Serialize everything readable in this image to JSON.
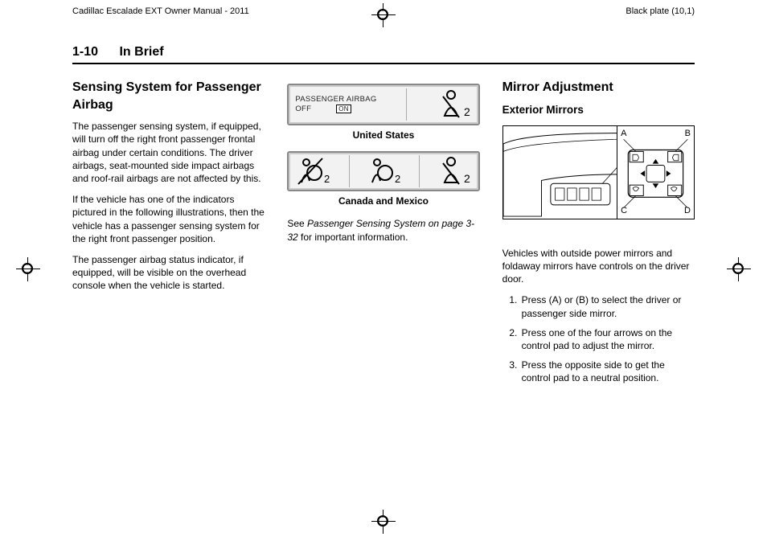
{
  "header": {
    "left": "Cadillac Escalade EXT Owner Manual - 2011",
    "right": "Black plate (10,1)"
  },
  "page": {
    "number": "1-10",
    "section": "In Brief"
  },
  "col1": {
    "h2": "Sensing System for Passenger Airbag",
    "p1": "The passenger sensing system, if equipped, will turn off the right front passenger frontal airbag under certain conditions. The driver airbags, seat-mounted side impact airbags and roof-rail airbags are not affected by this.",
    "p2": "If the vehicle has one of the indicators pictured in the following illustrations, then the vehicle has a passenger sensing system for the right front passenger position.",
    "p3": "The passenger airbag status indicator, if equipped, will be visible on the overhead console when the vehicle is started."
  },
  "col2": {
    "indicator_us_line1": "PASSENGER AIRBAG",
    "indicator_us_off": "OFF",
    "indicator_us_on": "ON",
    "caption_us": "United States",
    "caption_ca": "Canada and Mexico",
    "see_prefix": "See ",
    "see_ref": "Passenger Sensing System on page 3-32",
    "see_suffix": " for important information."
  },
  "col3": {
    "h2": "Mirror Adjustment",
    "h3": "Exterior Mirrors",
    "labels": {
      "A": "A",
      "B": "B",
      "C": "C",
      "D": "D"
    },
    "p1": "Vehicles with outside power mirrors and foldaway mirrors have controls on the driver door.",
    "li1": "Press (A) or (B) to select the driver or passenger side mirror.",
    "li2": "Press one of the four arrows on the control pad to adjust the mirror.",
    "li3": "Press the opposite side to get the control pad to a neutral position."
  }
}
